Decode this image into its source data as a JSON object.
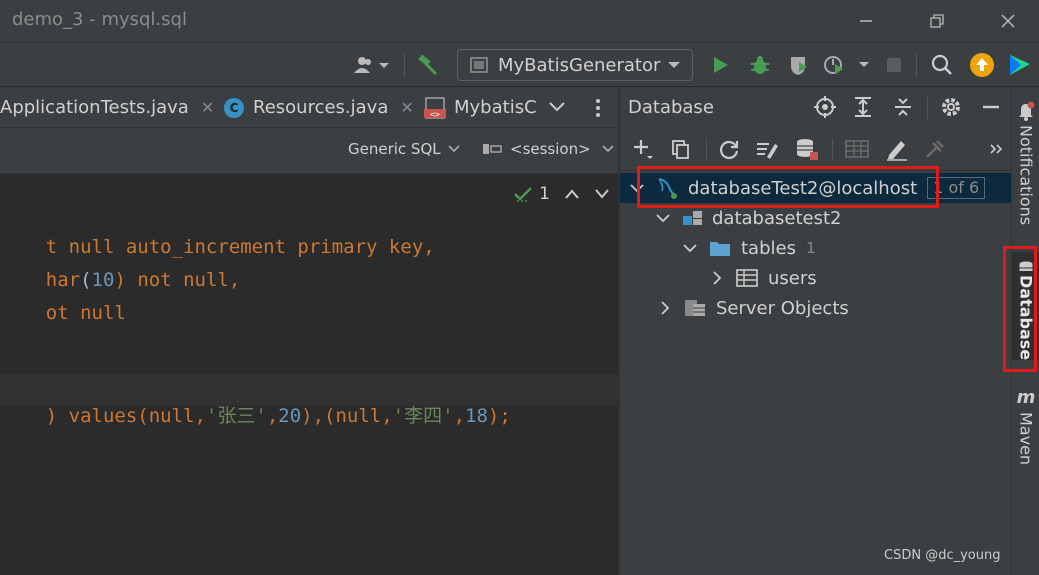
{
  "window": {
    "title": "demo_3 - mysql.sql"
  },
  "toolbar": {
    "run_config_label": "MyBatisGenerator"
  },
  "editor_tabs": [
    {
      "label": "ApplicationTests.java"
    },
    {
      "label": "Resources.java",
      "icon_letter": "C"
    },
    {
      "label": "MybatisC"
    }
  ],
  "editor_header": {
    "dialect": "Generic SQL",
    "session": "<session>"
  },
  "inspections": {
    "count": "1"
  },
  "code": {
    "line1": {
      "a": "t null auto_increment primary key,"
    },
    "line2": {
      "a": "har",
      "b": "(",
      "c": "10",
      "d": ") not null,"
    },
    "line3": {
      "a": "ot null"
    },
    "line4": {
      "a": ") values(null,",
      "b": "'张三'",
      "c": ",",
      "d": "20",
      "e": "),(null,",
      "f": "'李四'",
      "g": ",",
      "h": "18",
      "i": ");"
    }
  },
  "database_panel": {
    "title": "Database",
    "tree": {
      "datasource": {
        "label": "databaseTest2@localhost",
        "badge_num": "1",
        "badge_rest": "of 6"
      },
      "schema": {
        "label": "databasetest2"
      },
      "tables": {
        "label": "tables",
        "count": "1"
      },
      "table_users": {
        "label": "users"
      },
      "server_objects": {
        "label": "Server Objects"
      }
    }
  },
  "right_stripe": {
    "notifications": "Notifications",
    "database": "Database",
    "maven": "Maven"
  },
  "watermark": "CSDN @dc_young",
  "colors": {
    "highlight_red": "#e11a1a",
    "run_green": "#499c54",
    "selected_row": "#0d293e"
  }
}
